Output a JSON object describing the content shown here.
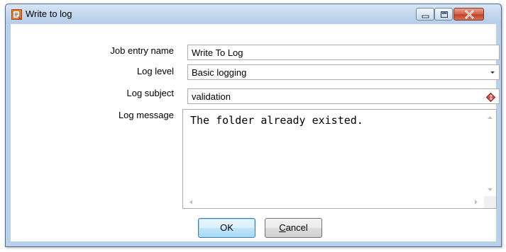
{
  "window": {
    "title": "Write to log"
  },
  "form": {
    "job_entry_name": {
      "label": "Job entry name",
      "value": "Write To Log"
    },
    "log_level": {
      "label": "Log level",
      "value": "Basic logging"
    },
    "log_subject": {
      "label": "Log subject",
      "value": "validation"
    },
    "log_message": {
      "label": "Log message",
      "value": "The folder already existed."
    }
  },
  "buttons": {
    "ok": "OK",
    "cancel_first": "C",
    "cancel_rest": "ancel"
  },
  "icons": {
    "app": "spoon-job-entry-icon",
    "variable": "variable-diamond-icon"
  },
  "colors": {
    "titlebar": "#c2d8ef",
    "close_button": "#c2442a",
    "default_button_border": "#3c7fb1"
  }
}
